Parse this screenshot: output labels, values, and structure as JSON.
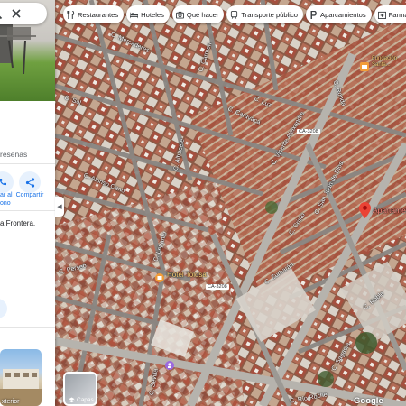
{
  "panel": {
    "reviews_text": "reseñas",
    "actions": [
      {
        "label_line1": "ar al",
        "label_line2": "ono",
        "icon": "phone-icon"
      },
      {
        "label_line1": "Compartir",
        "label_line2": "",
        "icon": "share-icon"
      }
    ],
    "address": "a Frontera,",
    "thumbnail_label": "xterior"
  },
  "chips": [
    {
      "label": "Restaurantes",
      "icon": "fork-knife-icon"
    },
    {
      "label": "Hoteles",
      "icon": "bed-icon"
    },
    {
      "label": "Qué hacer",
      "icon": "camera-icon"
    },
    {
      "label": "Transporte público",
      "icon": "train-icon"
    },
    {
      "label": "Aparcamientos",
      "icon": "parking-icon"
    },
    {
      "label": "Farmacias",
      "icon": "pharmacy-icon"
    }
  ],
  "map": {
    "street_labels": [
      "C. Mercaderes",
      "C. Carmen",
      "C. Sol",
      "C. Lepanto",
      "C. Vicente Aleixandre",
      "C. Alonso Cano",
      "C. Caravaca",
      "C. Luz",
      "C. Cristo",
      "C. Zurbarán",
      "C. Perseo",
      "C. Sevilla",
      "C. Río Roche",
      "C. Roble",
      "C. Ronda",
      "C. San Juan de Dios",
      "C. Albacete",
      "C. Sagasta"
    ],
    "road_shields": [
      "CA-3208",
      "CA-3208"
    ],
    "poi_labels": [
      "Hotel Tolosa",
      "Fundación Santa..."
    ],
    "destination_label": "Apartamento",
    "layers_label": "Capas",
    "attribution": "Google"
  },
  "colors": {
    "accent": "#1a73e8",
    "pin_red": "#ea4335",
    "poi_orange": "#f29c38",
    "poi_purple": "#9c6ade"
  }
}
